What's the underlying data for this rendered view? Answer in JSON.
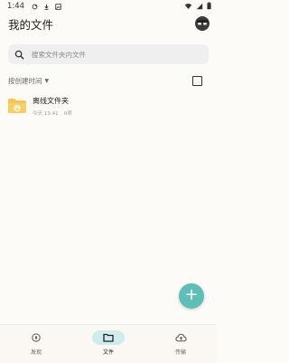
{
  "status_bar": {
    "time": "1:44"
  },
  "header": {
    "title": "我的文件"
  },
  "search": {
    "placeholder": "搜索文件夹内文件"
  },
  "sort": {
    "label": "按创建时间"
  },
  "files": [
    {
      "name": "离线文件夹",
      "date": "今天 13:41",
      "count": "0项"
    }
  ],
  "bottom_nav": {
    "items": [
      {
        "label": "发现",
        "icon": "compass-icon",
        "active": false
      },
      {
        "label": "文件",
        "icon": "folder-icon",
        "active": true
      },
      {
        "label": "传输",
        "icon": "cloud-transfer-icon",
        "active": false
      }
    ]
  },
  "colors": {
    "accent": "#5FBFB8",
    "active_pill": "#CFEDEC",
    "background": "#FDFBF8",
    "folder": "#F6C453"
  }
}
